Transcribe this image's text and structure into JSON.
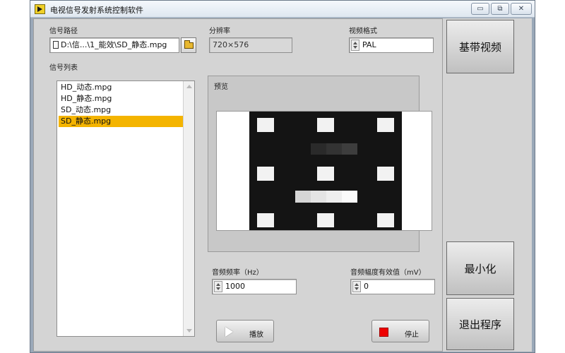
{
  "window": {
    "title": "电视信号发射系统控制软件",
    "controls": {
      "minimize": "▭",
      "restore": "⧉",
      "close": "✕"
    }
  },
  "signal_path": {
    "label": "信号路径",
    "value": "D:\\信...\\1_能效\\SD_静态.mpg"
  },
  "resolution": {
    "label": "分辨率",
    "value": "720×576"
  },
  "video_format": {
    "label": "视频格式",
    "value": "PAL"
  },
  "signal_list": {
    "label": "信号列表",
    "items": [
      "HD_动态.mpg",
      "HD_静态.mpg",
      "SD_动态.mpg",
      "SD_静态.mpg"
    ],
    "selected_index": 3
  },
  "preview": {
    "label": "预览"
  },
  "audio_freq": {
    "label": "音频频率（Hz）",
    "value": "1000"
  },
  "audio_amp": {
    "label": "音频幅度有效值（mV）",
    "value": "0"
  },
  "buttons": {
    "play": "播放",
    "stop": "停止",
    "baseband": "基带视频",
    "minimize": "最小化",
    "exit": "退出程序"
  },
  "colors": {
    "selection": "#f4b400",
    "stop": "#ee0000"
  }
}
